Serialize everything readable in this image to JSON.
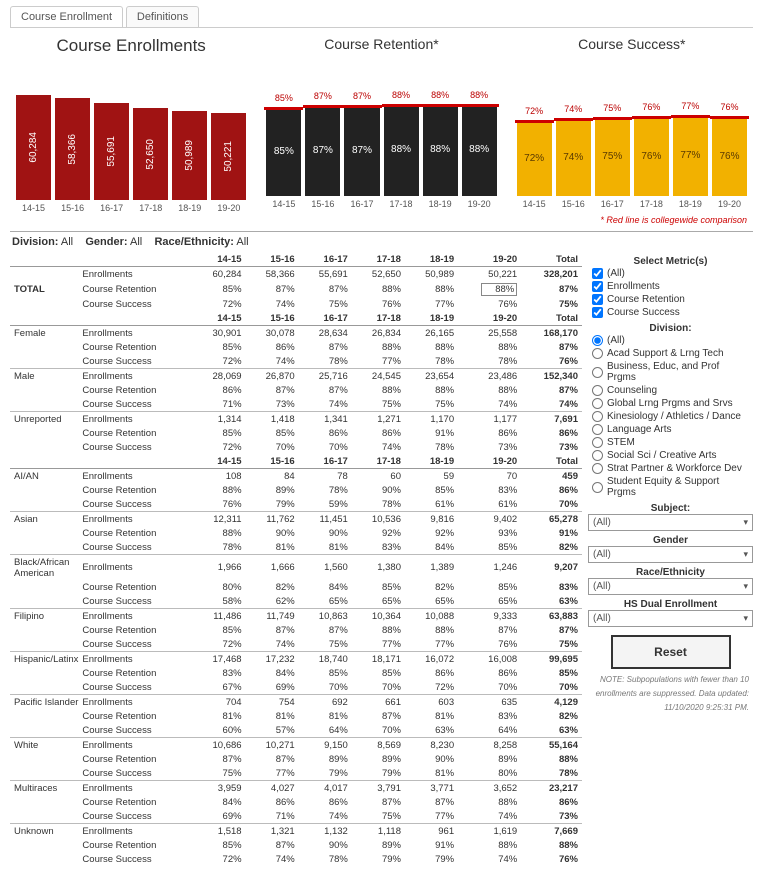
{
  "tabs": [
    "Course Enrollment",
    "Definitions"
  ],
  "chart_data": [
    {
      "type": "bar",
      "title": "Course Enrollments",
      "categories": [
        "14-15",
        "15-16",
        "16-17",
        "17-18",
        "18-19",
        "19-20"
      ],
      "values": [
        60284,
        58366,
        55691,
        52650,
        50989,
        50221
      ],
      "value_display": [
        "60,284",
        "58,366",
        "55,691",
        "52,650",
        "50,989",
        "50,221"
      ],
      "bar_color": "#a01313",
      "ylim": [
        0,
        60284
      ],
      "label_orientation": "vertical"
    },
    {
      "type": "bar",
      "title": "Course Retention*",
      "categories": [
        "14-15",
        "15-16",
        "16-17",
        "17-18",
        "18-19",
        "19-20"
      ],
      "values": [
        85,
        87,
        87,
        88,
        88,
        88
      ],
      "value_display": [
        "85%",
        "87%",
        "87%",
        "88%",
        "88%",
        "88%"
      ],
      "bar_color": "#222222",
      "ylim": [
        0,
        100
      ],
      "topline_values": [
        85,
        87,
        87,
        88,
        88,
        88
      ],
      "topline_display": [
        "85%",
        "87%",
        "87%",
        "88%",
        "88%",
        "88%"
      ],
      "topline_color": "#cc0000"
    },
    {
      "type": "bar",
      "title": "Course Success*",
      "categories": [
        "14-15",
        "15-16",
        "16-17",
        "17-18",
        "18-19",
        "19-20"
      ],
      "values": [
        72,
        74,
        75,
        76,
        77,
        76
      ],
      "value_display": [
        "72%",
        "74%",
        "75%",
        "76%",
        "77%",
        "76%"
      ],
      "bar_color": "#f2b100",
      "text_color": "#5a3a00",
      "ylim": [
        0,
        100
      ],
      "topline_values": [
        72,
        74,
        75,
        76,
        77,
        76
      ],
      "topline_display": [
        "72%",
        "74%",
        "75%",
        "76%",
        "77%",
        "76%"
      ],
      "topline_color": "#cc0000"
    }
  ],
  "redline_note": "* Red line is collegewide comparison",
  "active_filters": {
    "division_label": "Division:",
    "division_value": "All",
    "gender_label": "Gender:",
    "gender_value": "All",
    "race_label": "Race/Ethnicity:",
    "race_value": "All"
  },
  "table": {
    "columns": [
      "14-15",
      "15-16",
      "16-17",
      "17-18",
      "18-19",
      "19-20",
      "Total"
    ],
    "metric_labels": [
      "Enrollments",
      "Course Retention",
      "Course Success"
    ],
    "groups": [
      {
        "header_repeat": true,
        "rows": [
          {
            "label": "TOTAL",
            "enrollments": [
              "60,284",
              "58,366",
              "55,691",
              "52,650",
              "50,989",
              "50,221",
              "328,201"
            ],
            "retention": [
              "85%",
              "87%",
              "87%",
              "88%",
              "88%",
              "88%",
              "87%"
            ],
            "retention_boxed_index": 5,
            "success": [
              "72%",
              "74%",
              "75%",
              "76%",
              "77%",
              "76%",
              "75%"
            ]
          }
        ]
      },
      {
        "header_repeat": true,
        "rows": [
          {
            "label": "Female",
            "enrollments": [
              "30,901",
              "30,078",
              "28,634",
              "26,834",
              "26,165",
              "25,558",
              "168,170"
            ],
            "retention": [
              "85%",
              "86%",
              "87%",
              "88%",
              "88%",
              "88%",
              "87%"
            ],
            "success": [
              "72%",
              "74%",
              "78%",
              "77%",
              "78%",
              "78%",
              "76%"
            ]
          },
          {
            "label": "Male",
            "enrollments": [
              "28,069",
              "26,870",
              "25,716",
              "24,545",
              "23,654",
              "23,486",
              "152,340"
            ],
            "retention": [
              "86%",
              "87%",
              "87%",
              "88%",
              "88%",
              "88%",
              "87%"
            ],
            "success": [
              "71%",
              "73%",
              "74%",
              "75%",
              "75%",
              "74%",
              "74%"
            ]
          },
          {
            "label": "Unreported",
            "enrollments": [
              "1,314",
              "1,418",
              "1,341",
              "1,271",
              "1,170",
              "1,177",
              "7,691"
            ],
            "retention": [
              "85%",
              "85%",
              "86%",
              "86%",
              "91%",
              "86%",
              "86%"
            ],
            "success": [
              "72%",
              "70%",
              "70%",
              "74%",
              "78%",
              "73%",
              "73%"
            ]
          }
        ]
      },
      {
        "header_repeat": true,
        "rows": [
          {
            "label": "AI/AN",
            "enrollments": [
              "108",
              "84",
              "78",
              "60",
              "59",
              "70",
              "459"
            ],
            "retention": [
              "88%",
              "89%",
              "78%",
              "90%",
              "85%",
              "83%",
              "86%"
            ],
            "success": [
              "76%",
              "79%",
              "59%",
              "78%",
              "61%",
              "61%",
              "70%"
            ]
          },
          {
            "label": "Asian",
            "enrollments": [
              "12,311",
              "11,762",
              "11,451",
              "10,536",
              "9,816",
              "9,402",
              "65,278"
            ],
            "retention": [
              "88%",
              "90%",
              "90%",
              "92%",
              "92%",
              "93%",
              "91%"
            ],
            "success": [
              "78%",
              "81%",
              "81%",
              "83%",
              "84%",
              "85%",
              "82%"
            ]
          },
          {
            "label": "Black/African American",
            "enrollments": [
              "1,966",
              "1,666",
              "1,560",
              "1,380",
              "1,389",
              "1,246",
              "9,207"
            ],
            "retention": [
              "80%",
              "82%",
              "84%",
              "85%",
              "82%",
              "85%",
              "83%"
            ],
            "success": [
              "58%",
              "62%",
              "65%",
              "65%",
              "65%",
              "65%",
              "63%"
            ]
          },
          {
            "label": "Filipino",
            "enrollments": [
              "11,486",
              "11,749",
              "10,863",
              "10,364",
              "10,088",
              "9,333",
              "63,883"
            ],
            "retention": [
              "85%",
              "87%",
              "87%",
              "88%",
              "88%",
              "87%",
              "87%"
            ],
            "success": [
              "72%",
              "74%",
              "75%",
              "77%",
              "77%",
              "76%",
              "75%"
            ]
          },
          {
            "label": "Hispanic/Latinx",
            "enrollments": [
              "17,468",
              "17,232",
              "18,740",
              "18,171",
              "16,072",
              "16,008",
              "99,695"
            ],
            "retention": [
              "83%",
              "84%",
              "85%",
              "85%",
              "86%",
              "86%",
              "85%"
            ],
            "success": [
              "67%",
              "69%",
              "70%",
              "70%",
              "72%",
              "70%",
              "70%"
            ]
          },
          {
            "label": "Pacific Islander",
            "enrollments": [
              "704",
              "754",
              "692",
              "661",
              "603",
              "635",
              "4,129"
            ],
            "retention": [
              "81%",
              "81%",
              "81%",
              "87%",
              "81%",
              "83%",
              "82%"
            ],
            "success": [
              "60%",
              "57%",
              "64%",
              "70%",
              "63%",
              "64%",
              "63%"
            ]
          },
          {
            "label": "White",
            "enrollments": [
              "10,686",
              "10,271",
              "9,150",
              "8,569",
              "8,230",
              "8,258",
              "55,164"
            ],
            "retention": [
              "87%",
              "87%",
              "89%",
              "89%",
              "90%",
              "89%",
              "88%"
            ],
            "success": [
              "75%",
              "77%",
              "79%",
              "79%",
              "81%",
              "80%",
              "78%"
            ]
          },
          {
            "label": "Multiraces",
            "enrollments": [
              "3,959",
              "4,027",
              "4,017",
              "3,791",
              "3,771",
              "3,652",
              "23,217"
            ],
            "retention": [
              "84%",
              "86%",
              "86%",
              "87%",
              "87%",
              "88%",
              "86%"
            ],
            "success": [
              "69%",
              "71%",
              "74%",
              "75%",
              "77%",
              "74%",
              "73%"
            ]
          },
          {
            "label": "Unknown",
            "enrollments": [
              "1,518",
              "1,321",
              "1,132",
              "1,118",
              "961",
              "1,619",
              "7,669"
            ],
            "retention": [
              "85%",
              "87%",
              "90%",
              "89%",
              "91%",
              "88%",
              "88%"
            ],
            "success": [
              "72%",
              "74%",
              "78%",
              "79%",
              "79%",
              "74%",
              "76%"
            ]
          }
        ]
      }
    ]
  },
  "sidebar": {
    "metrics_title": "Select Metric(s)",
    "metrics": [
      "(All)",
      "Enrollments",
      "Course Retention",
      "Course Success"
    ],
    "division_title": "Division:",
    "division_options": [
      "(All)",
      "Acad Support & Lrng Tech",
      "Business, Educ, and Prof Prgms",
      "Counseling",
      "Global Lrng Prgms and Srvs",
      "Kinesiology / Athletics / Dance",
      "Language Arts",
      "STEM",
      "Social Sci / Creative Arts",
      "Strat Partner & Workforce Dev",
      "Student Equity & Support Prgms"
    ],
    "dropdowns": {
      "subject_label": "Subject:",
      "subject_value": "(All)",
      "gender_label": "Gender",
      "gender_value": "(All)",
      "race_label": "Race/Ethnicity",
      "race_value": "(All)",
      "dual_label": "HS Dual Enrollment",
      "dual_value": "(All)"
    },
    "reset": "Reset",
    "footnote1": "NOTE: Subpopulations with fewer than 10",
    "footnote2": "enrollments are suppressed. Data updated:",
    "footnote3": "11/10/2020 9:25:31 PM."
  }
}
